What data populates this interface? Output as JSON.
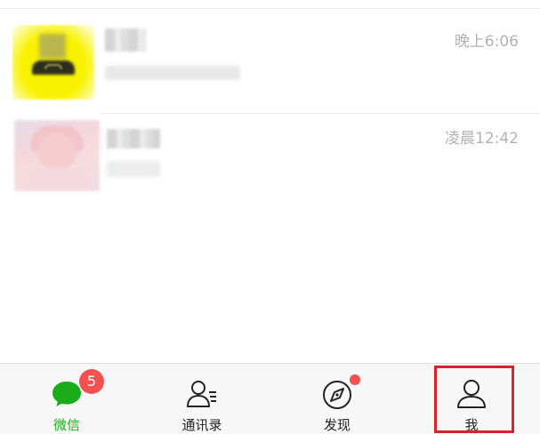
{
  "chat_list": {
    "conversations": [
      {
        "time": "晚上6:06"
      },
      {
        "time": "凌晨12:42"
      }
    ]
  },
  "tab_bar": {
    "tabs": [
      {
        "label": "微信",
        "badge": "5",
        "icon": "chat-bubble-icon",
        "active": true
      },
      {
        "label": "通讯录",
        "icon": "contacts-icon"
      },
      {
        "label": "发现",
        "icon": "compass-icon"
      },
      {
        "label": "我",
        "icon": "person-icon"
      }
    ]
  },
  "colors": {
    "accent_green": "#1aad19",
    "badge_red": "#f35050",
    "highlight_red": "#d9222a",
    "time_gray": "#b2b2b2"
  }
}
